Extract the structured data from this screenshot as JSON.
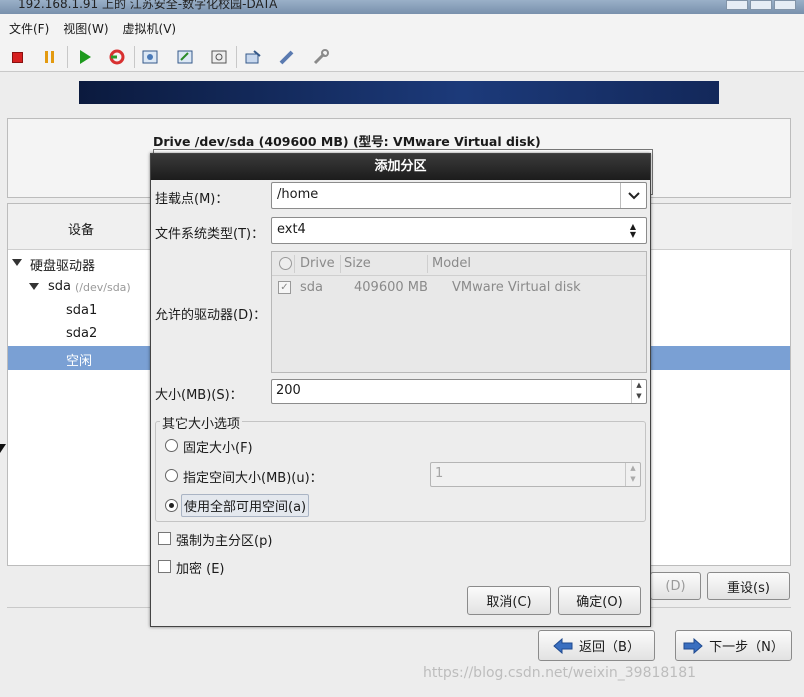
{
  "window": {
    "title": "192.168.1.91 上的 江苏安全-数字化校园-DATA"
  },
  "menu": [
    "文件(F)",
    "视图(W)",
    "虚拟机(V)"
  ],
  "toolbar_icons": [
    "stop-icon",
    "pause-icon",
    "play-icon",
    "refresh-icon",
    "snapshot-icon",
    "snapshot-revert-icon",
    "snapshot-manager-icon",
    "send-keys-icon",
    "tools-icon",
    "settings-icon"
  ],
  "installer": {
    "drive_title": "Drive /dev/sda (409600 MB) (型号: VMware Virtual disk)",
    "device_header": "设备",
    "tree": {
      "hard_drives": "硬盘驱动器",
      "sda": "sda",
      "sda_path": "(/dev/sda)",
      "sda1": "sda1",
      "sda2": "sda2",
      "free": "空闲"
    },
    "delete_btn_partial": "(D)",
    "reset_btn": "重设(s)",
    "back_btn": "返回（B）",
    "next_btn": "下一步（N）"
  },
  "dialog": {
    "title": "添加分区",
    "mount_label": "挂载点(M)：",
    "mount_value": "/home",
    "fstype_label": "文件系统类型(T)：",
    "fstype_value": "ext4",
    "drives_label": "允许的驱动器(D)：",
    "drives_columns": [
      "Drive",
      "Size",
      "Model"
    ],
    "drives_rows": [
      {
        "drive": "sda",
        "size": "409600 MB",
        "model": "VMware Virtual disk",
        "checked": true
      }
    ],
    "size_label": "大小(MB)(S)：",
    "size_value": "200",
    "other_options_legend": "其它大小选项",
    "opt_fixed": "固定大小(F)",
    "opt_upto": "指定空间大小(MB)(u)：",
    "opt_upto_value": "1",
    "opt_fill": "使用全部可用空间(a)",
    "selected_option": "fill",
    "force_primary": "强制为主分区(p)",
    "encrypt": "加密 (E)",
    "cancel_btn": "取消(C)",
    "ok_btn": "确定(O)"
  },
  "watermark": "https://blog.csdn.net/weixin_39818181",
  "colors": {
    "selection": "#7aa0d4",
    "banner": "#1c3a7a",
    "dialog_title": "#1c1c1c"
  }
}
